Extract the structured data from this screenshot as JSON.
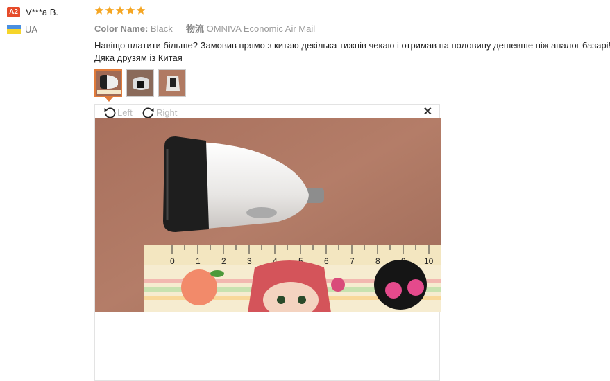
{
  "reviewer": {
    "level_badge": "A2",
    "name": "V***a B.",
    "country_code": "UA"
  },
  "rating": {
    "stars": 5,
    "max": 5,
    "color": "#f5a623"
  },
  "meta": {
    "color_label": "Color Name:",
    "color_value": "Black",
    "shipping_label": "物流",
    "shipping_value": "OMNIVA Economic Air Mail"
  },
  "review_text": "Навіщо платити більше? Замовив прямо з китаю декілька тижнів чекаю і отримав на половину дешевше ніж аналог базарі! Дяка друзям із Китая",
  "viewer": {
    "rotate_left_label": "Left",
    "rotate_right_label": "Right",
    "close_symbol": "✕"
  },
  "ruler_labels": [
    "0",
    "1",
    "2",
    "3",
    "4",
    "5",
    "6",
    "7",
    "8",
    "9",
    "10"
  ],
  "colors": {
    "accent": "#e07b3a",
    "badge": "#e64b2a"
  }
}
